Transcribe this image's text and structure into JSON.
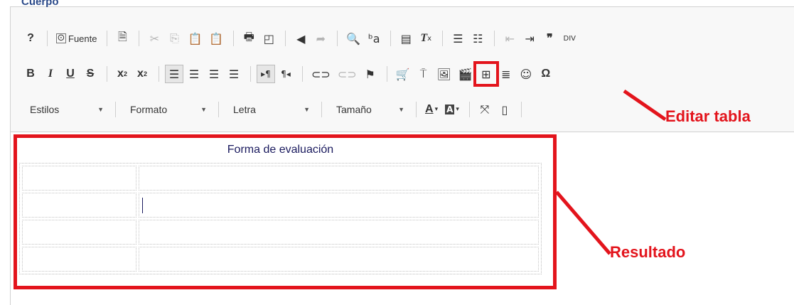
{
  "field": {
    "label": "Cuerpo"
  },
  "toolbar": {
    "source_label": "Fuente",
    "combos": {
      "styles": "Estilos",
      "format": "Formato",
      "font": "Letra",
      "size": "Tamaño"
    },
    "row1_icons": [
      "help-icon",
      "source-icon",
      "document-icon",
      "cut-icon",
      "copy-icon",
      "paste-icon",
      "paste-text-icon",
      "paste-word-icon",
      "print-icon",
      "undo-icon",
      "redo-icon",
      "find-icon",
      "replace-icon",
      "select-all-icon",
      "remove-format-icon",
      "numbered-list-icon",
      "bulleted-list-icon",
      "outdent-icon",
      "indent-icon",
      "blockquote-icon",
      "div-icon"
    ],
    "row2_icons": [
      "bold-icon",
      "italic-icon",
      "underline-icon",
      "strikethrough-icon",
      "subscript-icon",
      "superscript-icon",
      "align-left-icon",
      "align-center-icon",
      "align-right-icon",
      "justify-icon",
      "ltr-icon",
      "rtl-icon",
      "link-icon",
      "unlink-icon",
      "anchor-icon",
      "cart-icon",
      "pin-icon",
      "image-icon",
      "flash-icon",
      "table-icon",
      "horizontal-rule-icon",
      "smiley-icon",
      "special-char-icon"
    ]
  },
  "content": {
    "table_caption": "Forma de evaluación",
    "rows": 4,
    "cols": 2
  },
  "annotations": {
    "edit_table": "Editar tabla",
    "result": "Resultado",
    "color": "#e3141c"
  }
}
